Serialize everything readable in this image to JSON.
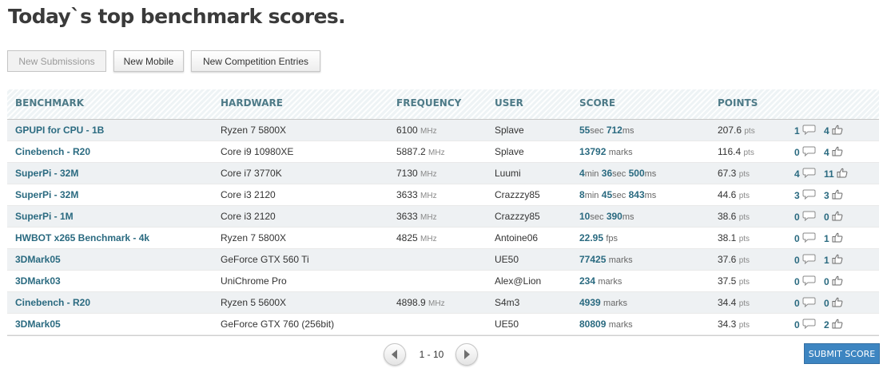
{
  "page": {
    "title": "Today`s top benchmark scores."
  },
  "tabs": [
    {
      "label": "New Submissions",
      "active": true
    },
    {
      "label": "New Mobile",
      "active": false
    },
    {
      "label": "New Competition Entries",
      "active": false
    }
  ],
  "table": {
    "headers": {
      "benchmark": "BENCHMARK",
      "hardware": "HARDWARE",
      "frequency": "FREQUENCY",
      "user": "USER",
      "score": "SCORE",
      "points": "POINTS"
    },
    "freq_unit": "MHz",
    "points_unit": "pts",
    "rows": [
      {
        "benchmark": "GPUPI for CPU - 1B",
        "hardware": "Ryzen 7 5800X",
        "frequency": "6100",
        "user": "Splave",
        "score": [
          {
            "n": "55",
            "u": "sec"
          },
          {
            "n": "712",
            "u": "ms"
          }
        ],
        "points": "207.6",
        "comments": "1",
        "likes": "4"
      },
      {
        "benchmark": "Cinebench - R20",
        "hardware": "Core i9 10980XE",
        "frequency": "5887.2",
        "user": "Splave",
        "score": [
          {
            "n": "13792",
            "u": "marks"
          }
        ],
        "points": "116.4",
        "comments": "0",
        "likes": "4"
      },
      {
        "benchmark": "SuperPi - 32M",
        "hardware": "Core i7 3770K",
        "frequency": "7130",
        "user": "Luumi",
        "score": [
          {
            "n": "4",
            "u": "min"
          },
          {
            "n": "36",
            "u": "sec"
          },
          {
            "n": "500",
            "u": "ms"
          }
        ],
        "points": "67.3",
        "comments": "4",
        "likes": "11"
      },
      {
        "benchmark": "SuperPi - 32M",
        "hardware": "Core i3 2120",
        "frequency": "3633",
        "user": "Crazzzy85",
        "score": [
          {
            "n": "8",
            "u": "min"
          },
          {
            "n": "45",
            "u": "sec"
          },
          {
            "n": "843",
            "u": "ms"
          }
        ],
        "points": "44.6",
        "comments": "3",
        "likes": "3"
      },
      {
        "benchmark": "SuperPi - 1M",
        "hardware": "Core i3 2120",
        "frequency": "3633",
        "user": "Crazzzy85",
        "score": [
          {
            "n": "10",
            "u": "sec"
          },
          {
            "n": "390",
            "u": "ms"
          }
        ],
        "points": "38.6",
        "comments": "0",
        "likes": "0"
      },
      {
        "benchmark": "HWBOT x265 Benchmark - 4k",
        "hardware": "Ryzen 7 5800X",
        "frequency": "4825",
        "user": "Antoine06",
        "score": [
          {
            "n": "22.95",
            "u": "fps"
          }
        ],
        "points": "38.1",
        "comments": "0",
        "likes": "1"
      },
      {
        "benchmark": "3DMark05",
        "hardware": "GeForce GTX 560 Ti",
        "frequency": "",
        "user": "UE50",
        "score": [
          {
            "n": "77425",
            "u": "marks"
          }
        ],
        "points": "37.6",
        "comments": "0",
        "likes": "1"
      },
      {
        "benchmark": "3DMark03",
        "hardware": "UniChrome Pro",
        "frequency": "",
        "user": "Alex@Lion",
        "score": [
          {
            "n": "234",
            "u": "marks"
          }
        ],
        "points": "37.5",
        "comments": "0",
        "likes": "0"
      },
      {
        "benchmark": "Cinebench - R20",
        "hardware": "Ryzen 5 5600X",
        "frequency": "4898.9",
        "user": "S4m3",
        "score": [
          {
            "n": "4939",
            "u": "marks"
          }
        ],
        "points": "34.4",
        "comments": "0",
        "likes": "0"
      },
      {
        "benchmark": "3DMark05",
        "hardware": "GeForce GTX 760 (256bit)",
        "frequency": "",
        "user": "UE50",
        "score": [
          {
            "n": "80809",
            "u": "marks"
          }
        ],
        "points": "34.3",
        "comments": "0",
        "likes": "2"
      }
    ]
  },
  "pagination": {
    "label": "1 - 10"
  },
  "actions": {
    "submit_label": "SUBMIT SCORE"
  },
  "colors": {
    "accent": "#2a6a80",
    "header_text": "#4d7a87",
    "submit_bg": "#3d85c1"
  },
  "icons": {
    "comments": "speech-bubble-icon",
    "likes": "thumbs-up-icon",
    "prev": "chevron-left-icon",
    "next": "chevron-right-icon"
  }
}
